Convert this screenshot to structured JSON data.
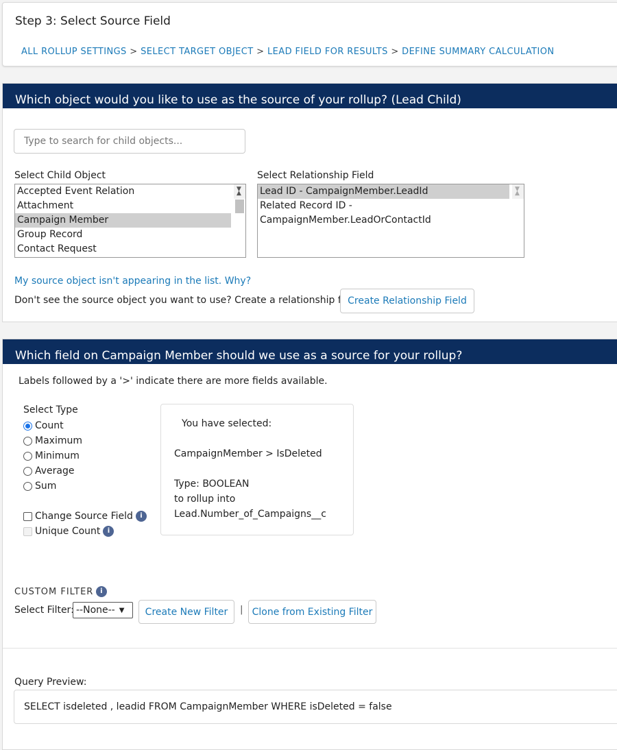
{
  "header": {
    "title": "Step 3: Select Source Field",
    "breadcrumbs": [
      "ALL ROLLUP SETTINGS",
      "SELECT TARGET OBJECT",
      "LEAD FIELD FOR RESULTS",
      "DEFINE SUMMARY CALCULATION"
    ],
    "separator": ">"
  },
  "source_object": {
    "title": "Which object would you like to use as the source of your rollup? (Lead Child)",
    "search_placeholder": "Type to search for child objects...",
    "child_label": "Select Child Object",
    "child_options": [
      "Accepted Event Relation",
      "Attachment",
      "Campaign Member",
      "Group Record",
      "Contact Request"
    ],
    "child_selected": "Campaign Member",
    "relationship_label": "Select Relationship Field",
    "relationship_options": [
      "Lead ID - CampaignMember.LeadId",
      "Related Record ID - CampaignMember.LeadOrContactId"
    ],
    "relationship_selected": "Lead ID - CampaignMember.LeadId",
    "help_link": "My source object isn't appearing in the list. Why?",
    "create_text": "Don't see the source object you want to use? Create a relationship field!",
    "create_button": "Create Relationship Field"
  },
  "source_field": {
    "title": "Which field on Campaign Member should we use as a source for your rollup?",
    "note": "Labels followed by a '>' indicate there are more fields available.",
    "type_label": "Select Type",
    "types": [
      "Count",
      "Maximum",
      "Minimum",
      "Average",
      "Sum"
    ],
    "type_selected": "Count",
    "change_source": "Change Source Field",
    "unique_count": "Unique Count",
    "selected": {
      "heading": "You have selected:",
      "path": "CampaignMember > IsDeleted",
      "type": "Type: BOOLEAN",
      "rollup_into": "to rollup into",
      "target": "Lead.Number_of_Campaigns__c"
    },
    "custom_filter_label": "CUSTOM FILTER",
    "select_filter_label": "Select Filter:",
    "filter_value": "--None--",
    "create_filter": "Create New Filter",
    "divider": "|",
    "clone_filter": "Clone from Existing Filter",
    "query_label": "Query Preview:",
    "query": "SELECT isdeleted , leadid FROM CampaignMember WHERE isDeleted = false"
  },
  "colors": {
    "header_bg": "#0c2d5e",
    "link": "#1b7ab8",
    "radio_selected": "#1a73e8"
  }
}
